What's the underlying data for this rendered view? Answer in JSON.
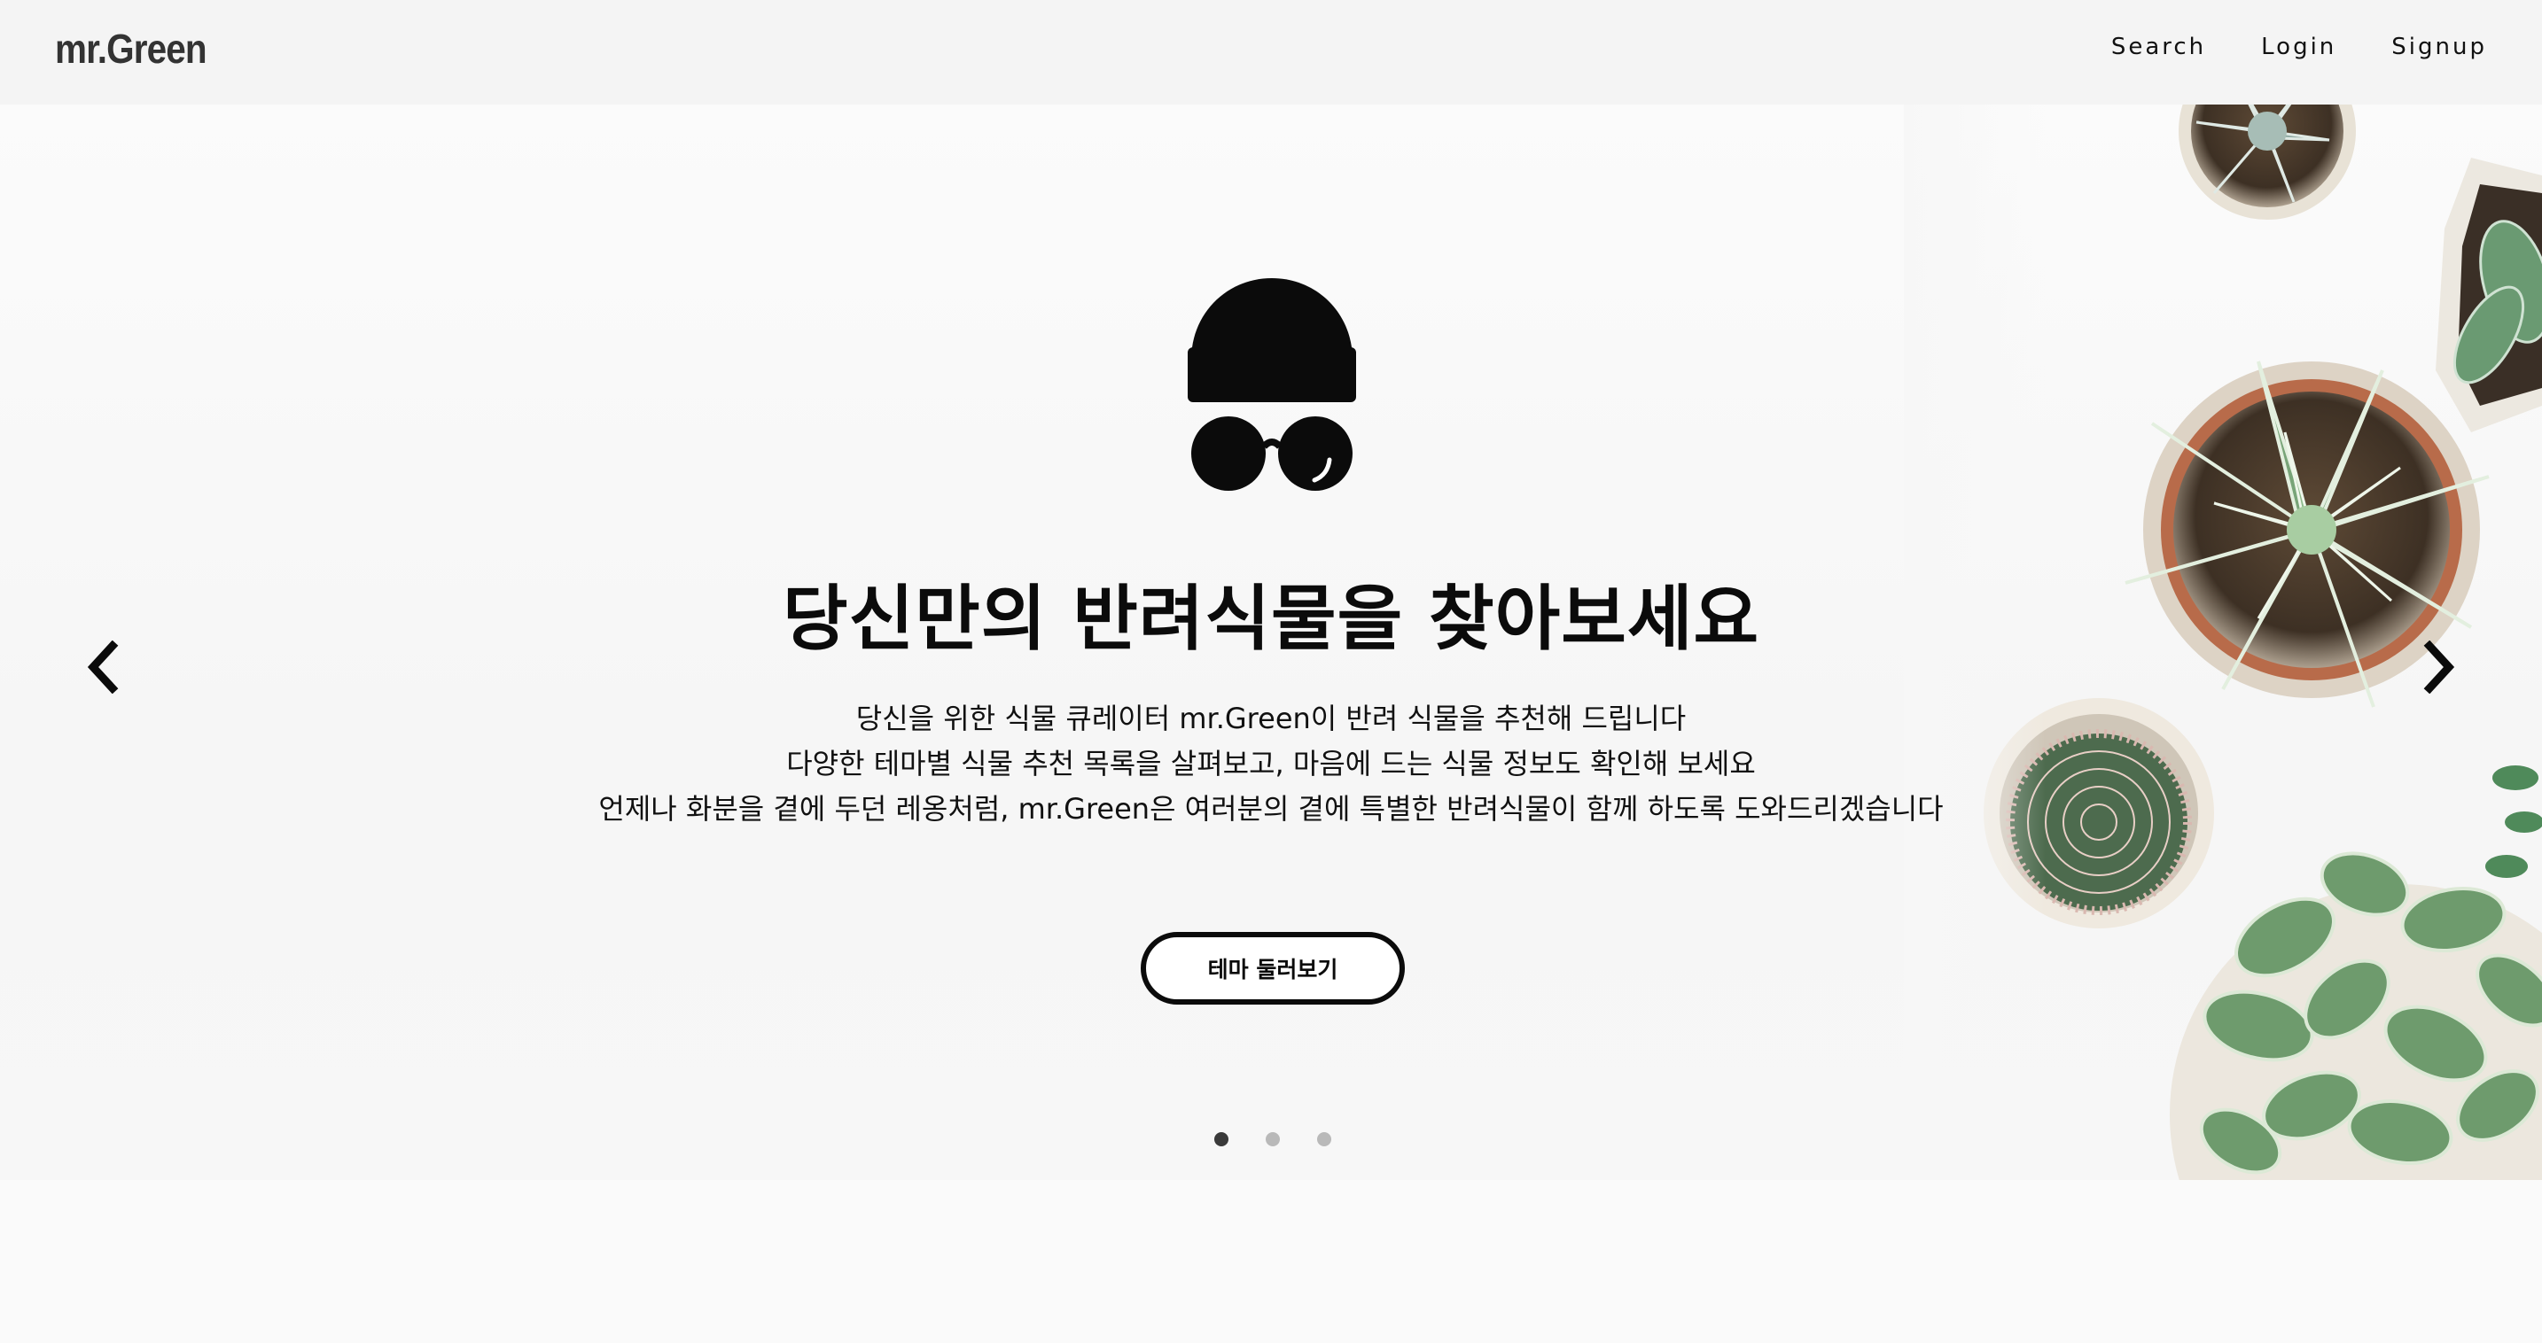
{
  "brand": {
    "name": "mr.Green"
  },
  "nav": {
    "links": [
      "Search",
      "Login",
      "Signup"
    ]
  },
  "hero": {
    "title": "당신만의 반려식물을 찾아보세요",
    "description": [
      "당신을 위한 식물 큐레이터 mr.Green이 반려 식물을 추천해 드립니다",
      "다양한 테마별 식물 추천 목록을 살펴보고, 마음에 드는 식물 정보도 확인해 보세요",
      "언제나 화분을 곁에 두던 레옹처럼, mr.Green은 여러분의 곁에 특별한 반려식물이 함께 하도록 도와드리겠습니다"
    ],
    "cta_label": "테마 둘러보기",
    "icon": "beanie-sunglasses-icon",
    "slides": {
      "count": 3,
      "active_index": 0
    }
  },
  "colors": {
    "text": "#0b0b0b",
    "navbar_bg": "#f4f4f4",
    "dot_active": "#3a3a3a",
    "dot_inactive": "#b9b9b9"
  }
}
